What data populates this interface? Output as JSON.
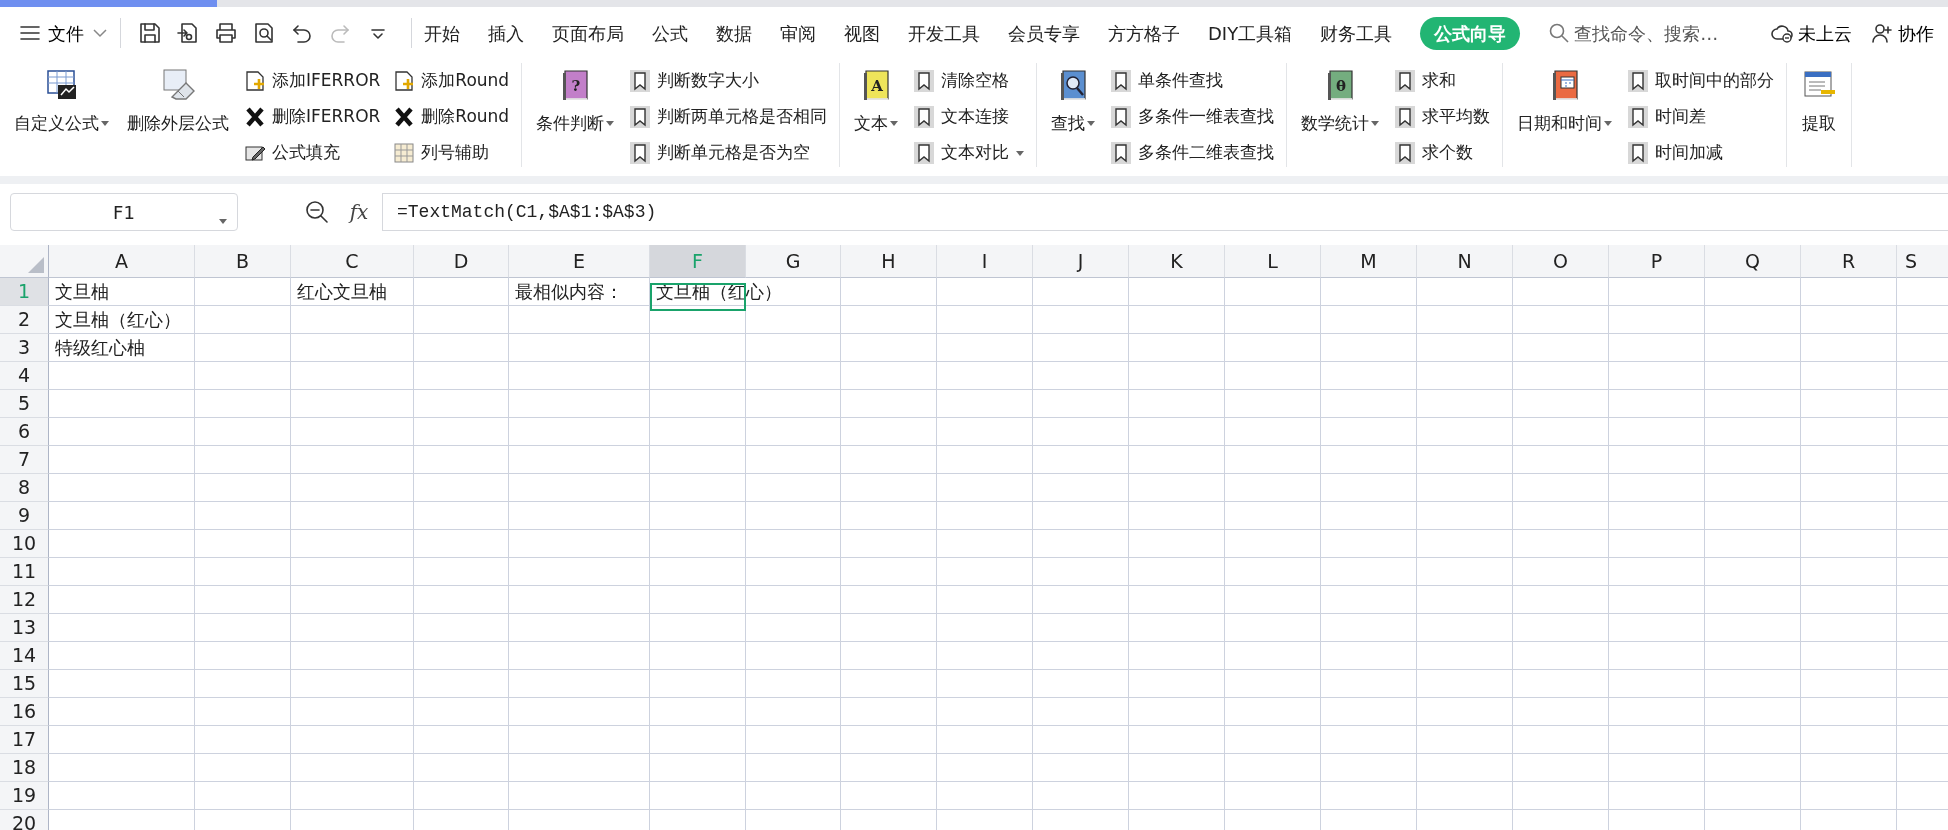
{
  "menu": {
    "file_label": "文件",
    "quick_access": [
      {
        "kind": "save",
        "disabled": false
      },
      {
        "kind": "export",
        "disabled": false
      },
      {
        "kind": "print",
        "disabled": false
      },
      {
        "kind": "preview",
        "disabled": false
      },
      {
        "kind": "undo",
        "disabled": false
      },
      {
        "kind": "redo",
        "disabled": true
      },
      {
        "kind": "more",
        "disabled": false
      }
    ],
    "tabs": [
      {
        "label": "开始",
        "selected": false
      },
      {
        "label": "插入",
        "selected": false
      },
      {
        "label": "页面布局",
        "selected": false
      },
      {
        "label": "公式",
        "selected": false
      },
      {
        "label": "数据",
        "selected": false
      },
      {
        "label": "审阅",
        "selected": false
      },
      {
        "label": "视图",
        "selected": false
      },
      {
        "label": "开发工具",
        "selected": false
      },
      {
        "label": "会员专享",
        "selected": false
      },
      {
        "label": "方方格子",
        "selected": false
      },
      {
        "label": "DIY工具箱",
        "selected": false
      },
      {
        "label": "财务工具",
        "selected": false
      },
      {
        "label": "公式向导",
        "selected": true
      }
    ],
    "search": {
      "placeholder": "查找命令、搜索…"
    },
    "actions": [
      {
        "kind": "cloud",
        "label": "未上云"
      },
      {
        "kind": "collab",
        "label": "协作"
      }
    ]
  },
  "ribbon": {
    "groups": [
      {
        "large": [
          {
            "icon": {
              "kind": "sheet"
            },
            "label": "自定义公式",
            "dropdown": true
          },
          {
            "icon": {
              "kind": "eraser"
            },
            "label": "删除外层公式",
            "dropdown": false
          }
        ],
        "columns": [
          [
            {
              "kind": "doc-plus",
              "label": "添加IFERROR",
              "dropdown": false
            },
            {
              "kind": "cross",
              "label": "删除IFERROR",
              "dropdown": false
            },
            {
              "kind": "pen",
              "label": "公式填充",
              "dropdown": false
            }
          ],
          [
            {
              "kind": "doc-plus",
              "label": "添加Round",
              "dropdown": false
            },
            {
              "kind": "cross",
              "label": "删除Round",
              "dropdown": false
            },
            {
              "kind": "grid",
              "label": "列号辅助",
              "dropdown": false
            }
          ]
        ]
      },
      {
        "large": [
          {
            "icon": {
              "kind": "book",
              "color": "#c27fc9",
              "glyph": "?"
            },
            "label": "条件判断",
            "dropdown": true
          }
        ],
        "columns": [
          [
            {
              "kind": "bookmark",
              "label": "判断数字大小",
              "dropdown": false
            },
            {
              "kind": "bookmark",
              "label": "判断两单元格是否相同",
              "dropdown": false
            },
            {
              "kind": "bookmark",
              "label": "判断单元格是否为空",
              "dropdown": false
            }
          ]
        ]
      },
      {
        "large": [
          {
            "icon": {
              "kind": "book",
              "color": "#eee45a",
              "glyph": "A"
            },
            "label": "文本",
            "dropdown": true
          }
        ],
        "columns": [
          [
            {
              "kind": "bookmark",
              "label": "清除空格",
              "dropdown": false
            },
            {
              "kind": "bookmark",
              "label": "文本连接",
              "dropdown": false
            },
            {
              "kind": "bookmark",
              "label": "文本对比",
              "dropdown": true
            }
          ]
        ]
      },
      {
        "large": [
          {
            "icon": {
              "kind": "book-magnifier",
              "color": "#5b8fd0"
            },
            "label": "查找",
            "dropdown": true
          }
        ],
        "columns": [
          [
            {
              "kind": "bookmark",
              "label": "单条件查找",
              "dropdown": false
            },
            {
              "kind": "bookmark",
              "label": "多条件一维表查找",
              "dropdown": false
            },
            {
              "kind": "bookmark",
              "label": "多条件二维表查找",
              "dropdown": false
            }
          ]
        ]
      },
      {
        "large": [
          {
            "icon": {
              "kind": "book",
              "color": "#74ad7f",
              "glyph": "θ"
            },
            "label": "数学统计",
            "dropdown": true
          }
        ],
        "columns": [
          [
            {
              "kind": "bookmark",
              "label": "求和",
              "dropdown": false
            },
            {
              "kind": "bookmark",
              "label": "求平均数",
              "dropdown": false
            },
            {
              "kind": "bookmark",
              "label": "求个数",
              "dropdown": false
            }
          ]
        ]
      },
      {
        "large": [
          {
            "icon": {
              "kind": "book-calendar",
              "color": "#ea6a42"
            },
            "label": "日期和时间",
            "dropdown": true
          }
        ],
        "columns": [
          [
            {
              "kind": "bookmark",
              "label": "取时间中的部分",
              "dropdown": false
            },
            {
              "kind": "bookmark",
              "label": "时间差",
              "dropdown": false
            },
            {
              "kind": "bookmark",
              "label": "时间加减",
              "dropdown": false
            }
          ]
        ]
      },
      {
        "large": [
          {
            "icon": {
              "kind": "document"
            },
            "label": "提取",
            "dropdown": false
          }
        ]
      }
    ]
  },
  "formula_bar": {
    "name_box": "F1",
    "fx_label": "fx",
    "formula": "=TextMatch(C1,$A$1:$A$3)"
  },
  "sheet": {
    "columns": [
      {
        "label": "A",
        "selected": false
      },
      {
        "label": "B",
        "selected": false
      },
      {
        "label": "C",
        "selected": false
      },
      {
        "label": "D",
        "selected": false
      },
      {
        "label": "E",
        "selected": false
      },
      {
        "label": "F",
        "selected": true
      },
      {
        "label": "G",
        "selected": false
      },
      {
        "label": "H",
        "selected": false
      },
      {
        "label": "I",
        "selected": false
      },
      {
        "label": "J",
        "selected": false
      },
      {
        "label": "K",
        "selected": false
      },
      {
        "label": "L",
        "selected": false
      },
      {
        "label": "M",
        "selected": false
      },
      {
        "label": "N",
        "selected": false
      },
      {
        "label": "O",
        "selected": false
      },
      {
        "label": "P",
        "selected": false
      },
      {
        "label": "Q",
        "selected": false
      },
      {
        "label": "R",
        "selected": false
      },
      {
        "label": "S",
        "selected": false
      }
    ],
    "rows": [
      {
        "label": "1",
        "selected": true,
        "cells": {
          "A": "文旦柚",
          "C": "红心文旦柚",
          "E": "最相似内容：",
          "F": "文旦柚（红心）"
        }
      },
      {
        "label": "2",
        "selected": false,
        "cells": {
          "A": "文旦柚（红心）"
        }
      },
      {
        "label": "3",
        "selected": false,
        "cells": {
          "A": "特级红心柚"
        }
      },
      {
        "label": "4",
        "selected": false,
        "cells": {}
      },
      {
        "label": "5",
        "selected": false,
        "cells": {}
      },
      {
        "label": "6",
        "selected": false,
        "cells": {}
      },
      {
        "label": "7",
        "selected": false,
        "cells": {}
      },
      {
        "label": "8",
        "selected": false,
        "cells": {}
      },
      {
        "label": "9",
        "selected": false,
        "cells": {}
      },
      {
        "label": "10",
        "selected": false,
        "cells": {}
      },
      {
        "label": "11",
        "selected": false,
        "cells": {}
      },
      {
        "label": "12",
        "selected": false,
        "cells": {}
      },
      {
        "label": "13",
        "selected": false,
        "cells": {}
      },
      {
        "label": "14",
        "selected": false,
        "cells": {}
      },
      {
        "label": "15",
        "selected": false,
        "cells": {}
      },
      {
        "label": "16",
        "selected": false,
        "cells": {}
      },
      {
        "label": "17",
        "selected": false,
        "cells": {}
      },
      {
        "label": "18",
        "selected": false,
        "cells": {}
      },
      {
        "label": "19",
        "selected": false,
        "cells": {}
      },
      {
        "label": "20",
        "selected": false,
        "cells": {}
      }
    ]
  }
}
